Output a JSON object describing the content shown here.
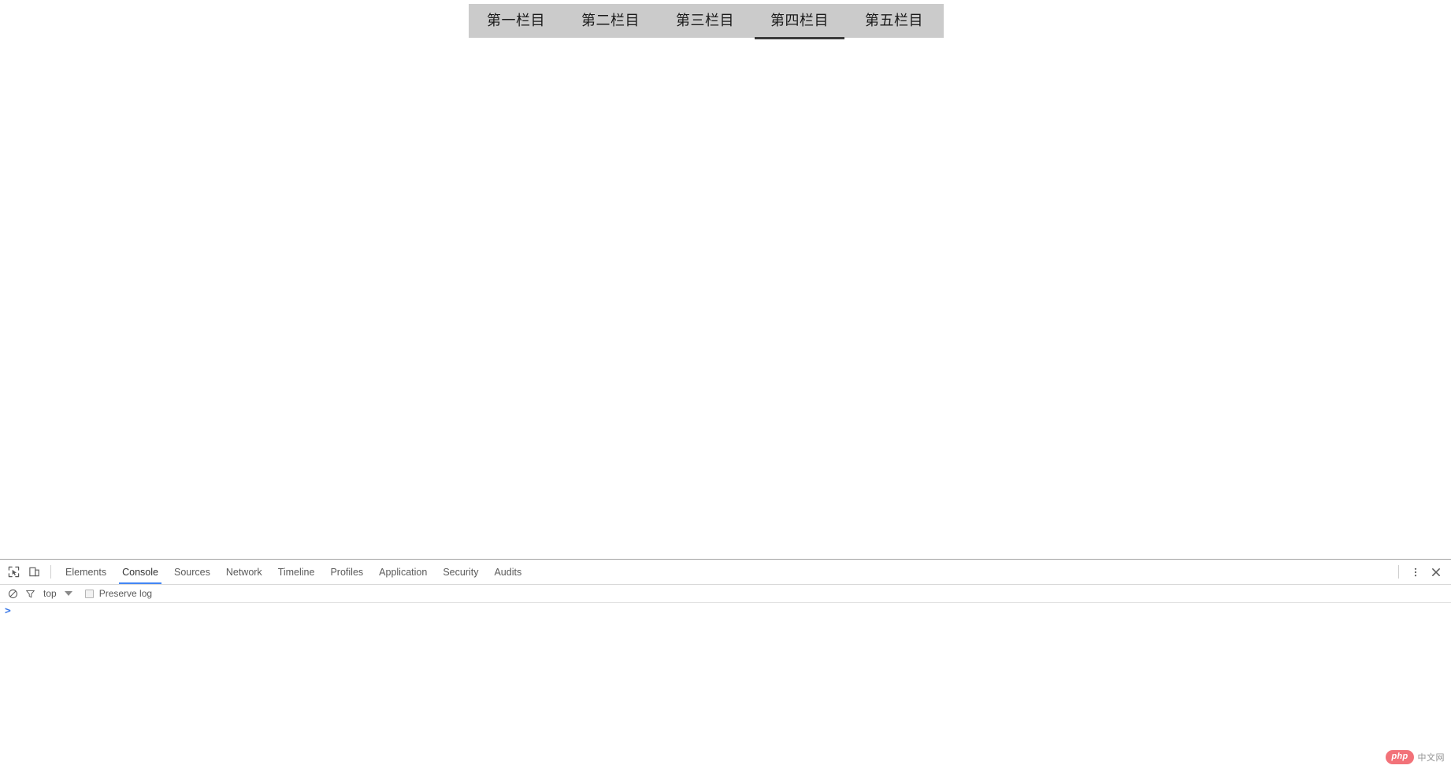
{
  "page": {
    "background_color": "#ffffff",
    "nav": {
      "background_color": "#cbcbcb",
      "active_underline_color": "#3c3c3c",
      "tabs": [
        {
          "label": "第一栏目",
          "active": false
        },
        {
          "label": "第二栏目",
          "active": false
        },
        {
          "label": "第三栏目",
          "active": false
        },
        {
          "label": "第四栏目",
          "active": true
        },
        {
          "label": "第五栏目",
          "active": false
        }
      ]
    }
  },
  "devtools": {
    "accent_color": "#4285f4",
    "icons": {
      "inspect": "inspect-element-icon",
      "device": "device-toolbar-icon",
      "more": "more-options-icon",
      "close": "close-icon",
      "clear": "clear-console-icon",
      "filter": "filter-icon"
    },
    "tabs": [
      {
        "label": "Elements",
        "active": false
      },
      {
        "label": "Console",
        "active": true
      },
      {
        "label": "Sources",
        "active": false
      },
      {
        "label": "Network",
        "active": false
      },
      {
        "label": "Timeline",
        "active": false
      },
      {
        "label": "Profiles",
        "active": false
      },
      {
        "label": "Application",
        "active": false
      },
      {
        "label": "Security",
        "active": false
      },
      {
        "label": "Audits",
        "active": false
      }
    ],
    "console": {
      "context": "top",
      "preserve_log_label": "Preserve log",
      "preserve_log_checked": false,
      "prompt_symbol": ">",
      "prompt_value": "",
      "prompt_placeholder": ""
    }
  },
  "watermark": {
    "badge": "php",
    "text": "中文网",
    "badge_color": "#f26b72"
  }
}
